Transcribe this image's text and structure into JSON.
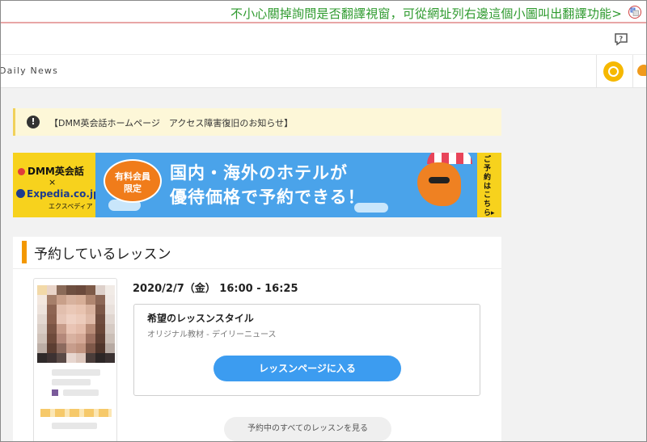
{
  "annotation": {
    "text": "不小心關掉詢問是否翻譯視窗，可從網址列右邊這個小圖叫出翻譯功能>",
    "color": "#2e9a2e",
    "icon": "translate-icon"
  },
  "header": {
    "help_icon": "help-chat-icon"
  },
  "nav": {
    "title": "Daily News",
    "q_button": "Q",
    "q_color": "#f6b800",
    "mascot_icon": "mascot-icon"
  },
  "notice": {
    "icon": "!",
    "text": "【DMM英会話ホームページ　アクセス障害復旧のお知らせ】"
  },
  "banner": {
    "dmm_logo": "DMM英会話",
    "x": "×",
    "expedia_logo": "Expedia.co.jp",
    "expedia_sub": "エクスペディア",
    "badge_line1": "有料会員",
    "badge_line2": "限定",
    "headline_line1": "国内・海外のホテルが",
    "headline_line2": "優待価格で予約できる！",
    "cta": "ご予約はこちら▸"
  },
  "lesson_card": {
    "title": "予約しているレッスン",
    "accent_color": "#f39800",
    "datetime": "2020/2/7（金） 16:00 - 16:25",
    "style_label": "希望のレッスンスタイル",
    "style_value": "オリジナル教材 - デイリーニュース",
    "enter_button": "レッスンページに入る",
    "all_lessons_button": "予約中のすべてのレッスンを見る",
    "button_color": "#3c9cf0"
  }
}
